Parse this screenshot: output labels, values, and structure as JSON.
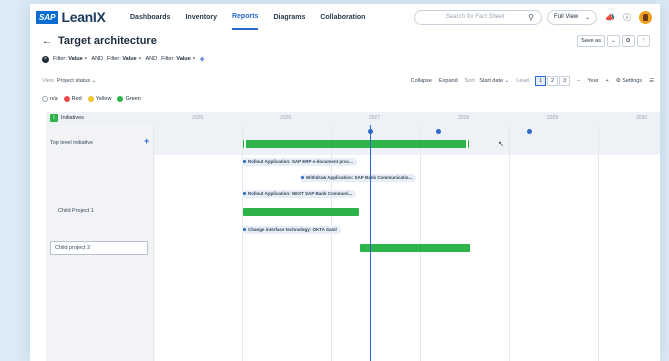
{
  "app": {
    "brand_sap": "SAP",
    "brand_name": "LeanIX"
  },
  "nav": {
    "items": [
      "Dashboards",
      "Inventory",
      "Reports",
      "Diagrams",
      "Collaboration"
    ],
    "active": "Reports"
  },
  "search": {
    "placeholder": "Search for Fact Sheet"
  },
  "view_select": {
    "value": "Full View"
  },
  "page": {
    "title": "Target architecture",
    "save_as": "Save as"
  },
  "filters": [
    {
      "label": "Filter:",
      "value": "Value"
    },
    {
      "label": "Filter:",
      "value": "Value"
    },
    {
      "label": "Filter:",
      "value": "Value"
    }
  ],
  "filter_joiner": "AND",
  "toolbar": {
    "view_label": "View",
    "view_value": "Project status",
    "collapse": "Collapse",
    "expand": "Expand",
    "sort_label": "Sort",
    "sort_value": "Start date",
    "level_label": "Level",
    "levels": [
      "1",
      "2",
      "3"
    ],
    "minus": "−",
    "zoom": "Year",
    "plus": "+",
    "settings": "Settings"
  },
  "legend": [
    {
      "label": "n/a",
      "color": "#ffffff"
    },
    {
      "label": "Red",
      "color": "#e84b4b"
    },
    {
      "label": "Yellow",
      "color": "#f2c12e"
    },
    {
      "label": "Green",
      "color": "#2db34a"
    }
  ],
  "timeline": {
    "header_label": "Initiatives",
    "years": [
      "2025",
      "2026",
      "2027",
      "2028",
      "2029",
      "2030"
    ],
    "rows": [
      {
        "label": "Top level initiative"
      },
      {
        "label": "Child Project 1"
      },
      {
        "label": "Child project 2"
      }
    ],
    "dependencies": [
      "Rollout Application: SAP ERP e-document proc...",
      "Withdraw Application: SAP Bank Communicatio...",
      "Rollout Application: NEXT SAP Bank Communi...",
      "Change interface technology: OKTA Saml"
    ]
  }
}
